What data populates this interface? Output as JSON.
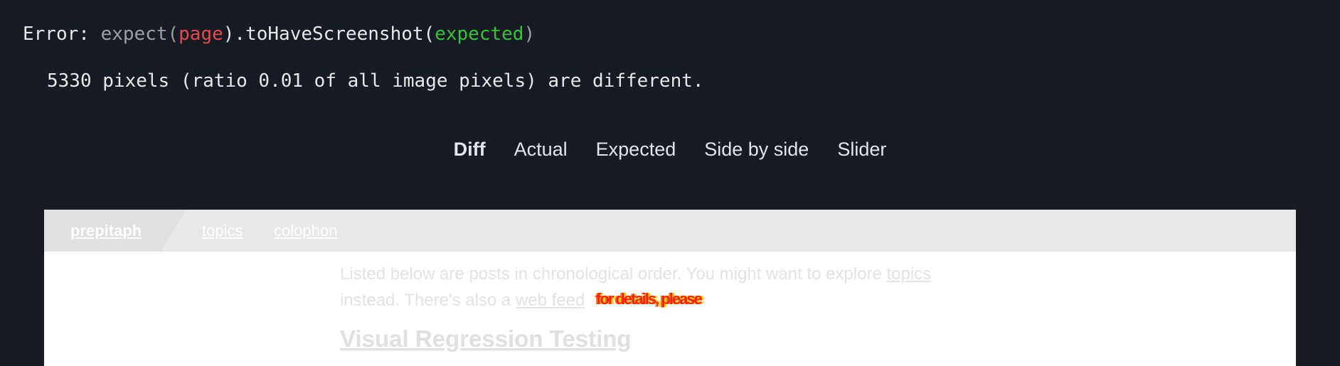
{
  "error": {
    "prefix": "Error: ",
    "call_open": "expect(",
    "subject": "page",
    "call_mid": ").toHaveScreenshot(",
    "argument": "expected",
    "call_close": ")",
    "detail": "5330 pixels (ratio 0.01 of all image pixels) are different."
  },
  "tabs": [
    {
      "label": "Diff",
      "active": true
    },
    {
      "label": "Actual",
      "active": false
    },
    {
      "label": "Expected",
      "active": false
    },
    {
      "label": "Side by side",
      "active": false
    },
    {
      "label": "Slider",
      "active": false
    }
  ],
  "preview": {
    "brand": "prepitaph",
    "nav": [
      "topics",
      "colophon"
    ],
    "intro_part1": "Listed below are posts in chronological order. You might want to explore ",
    "intro_link1": "topics",
    "intro_part2": " instead. There's also a ",
    "intro_link2": "web feed",
    "diff_overlay": "for details, please",
    "post_title": "Visual Regression Testing"
  },
  "colors": {
    "background": "#171b23",
    "error_subject": "#e5484d",
    "error_argument": "#32c33a",
    "diff_highlight": "#ff1a1a"
  }
}
